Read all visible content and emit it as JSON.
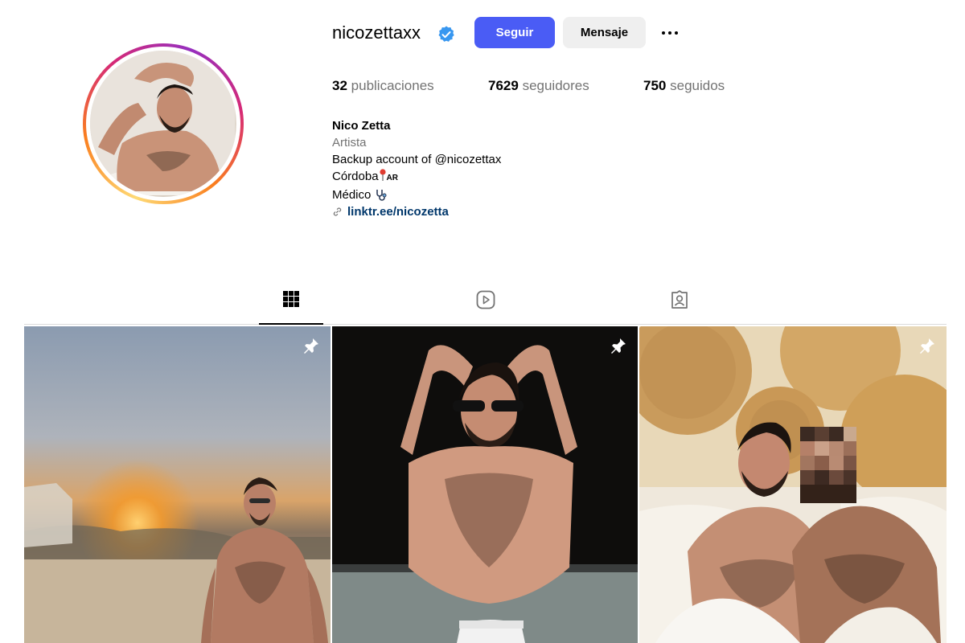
{
  "profile": {
    "username": "nicozettaxx",
    "verified": true,
    "follow_label": "Seguir",
    "message_label": "Mensaje",
    "more_icon": "more-horizontal-icon"
  },
  "stats": {
    "posts_count": "32",
    "posts_label": "publicaciones",
    "followers_count": "7629",
    "followers_label": "seguidores",
    "following_count": "750",
    "following_label": "seguidos"
  },
  "bio": {
    "name": "Nico Zetta",
    "category": "Artista",
    "line1": "Backup account of @nicozettax",
    "line2_text": "Córdoba",
    "line2_flag": "AR",
    "line3_text": "Médico",
    "link": "linktr.ee/nicozetta"
  },
  "tabs": [
    {
      "name": "posts",
      "icon": "grid-icon",
      "active": true
    },
    {
      "name": "reels",
      "icon": "reels-icon",
      "active": false
    },
    {
      "name": "tagged",
      "icon": "tagged-icon",
      "active": false
    }
  ],
  "colors": {
    "follow_button": "#4a5cf5",
    "verified_badge": "#3897f0",
    "link": "#00376b"
  },
  "posts": [
    {
      "pinned": true,
      "description": "beach sunset"
    },
    {
      "pinned": true,
      "description": "night flash portrait"
    },
    {
      "pinned": true,
      "description": "bed with woven fans"
    }
  ]
}
